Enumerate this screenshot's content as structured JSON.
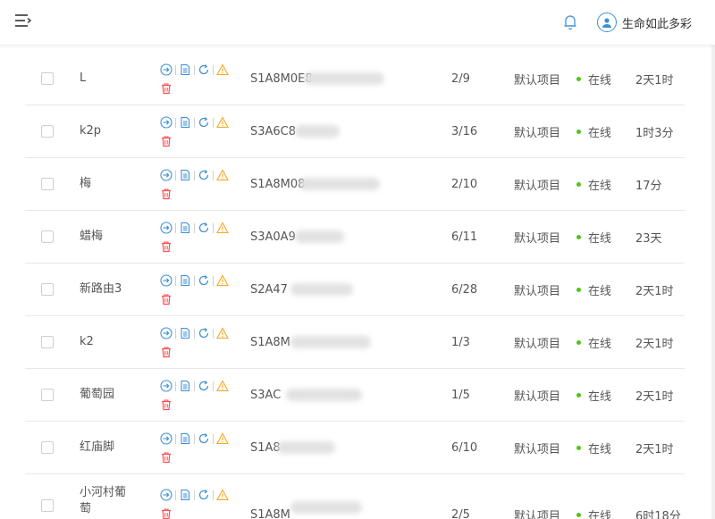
{
  "header": {
    "menu_icon": "menu-fold-icon",
    "bell_icon": "bell-icon",
    "avatar_icon": "user-icon",
    "username": "生命如此多彩"
  },
  "colors": {
    "accent": "#3d8fd6",
    "danger": "#ff4d4f",
    "warning": "#f5a623",
    "online": "#52c41a"
  },
  "actions": [
    "login-icon",
    "document-icon",
    "refresh-icon",
    "warning-icon",
    "delete-icon"
  ],
  "rows": [
    {
      "name": "L",
      "sn": "S1A8M0E8",
      "ratio": "2/9",
      "project": "默认项目",
      "status": "在线",
      "duration": "2天1时"
    },
    {
      "name": "k2p",
      "sn": "S3A6C8",
      "ratio": "3/16",
      "project": "默认项目",
      "status": "在线",
      "duration": "1时3分"
    },
    {
      "name": "梅",
      "sn": "S1A8M08",
      "ratio": "2/10",
      "project": "默认项目",
      "status": "在线",
      "duration": "17分"
    },
    {
      "name": "蜡梅",
      "sn": "S3A0A9",
      "ratio": "6/11",
      "project": "默认项目",
      "status": "在线",
      "duration": "23天"
    },
    {
      "name": "新路由3",
      "sn": "S2A47",
      "ratio": "6/28",
      "project": "默认项目",
      "status": "在线",
      "duration": "2天1时"
    },
    {
      "name": "k2",
      "sn": "S1A8M",
      "ratio": "1/3",
      "project": "默认项目",
      "status": "在线",
      "duration": "2天1时"
    },
    {
      "name": "葡萄园",
      "sn": "S3AC",
      "ratio": "1/5",
      "project": "默认项目",
      "status": "在线",
      "duration": "2天1时"
    },
    {
      "name": "红庙脚",
      "sn": "S1A8",
      "ratio": "6/10",
      "project": "默认项目",
      "status": "在线",
      "duration": "2天1时"
    },
    {
      "name": "小河村葡萄",
      "sn": "S1A8M",
      "ratio": "2/5",
      "project": "默认项目",
      "status": "在线",
      "duration": "6时18分"
    }
  ]
}
